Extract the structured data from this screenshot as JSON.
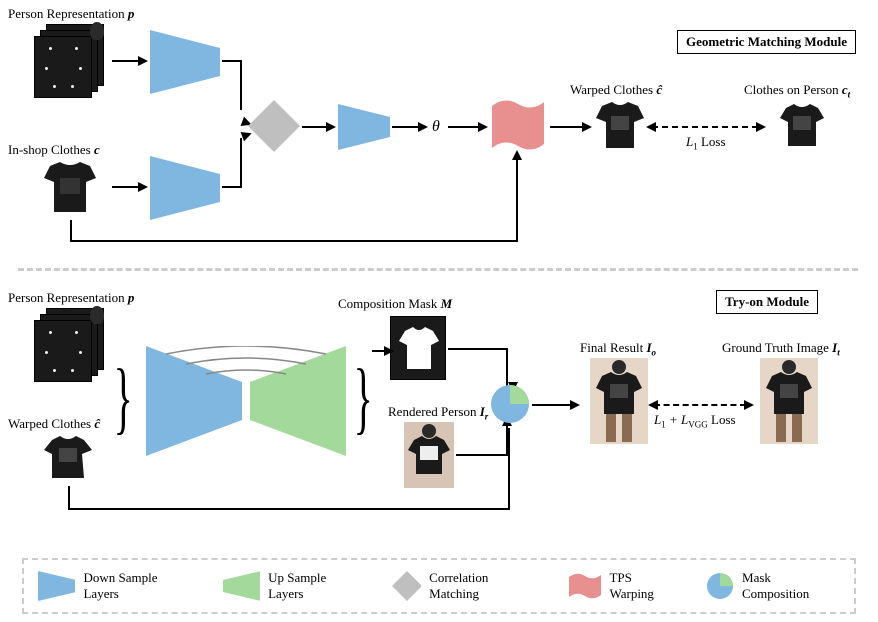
{
  "module1": {
    "title": "Geometric Matching Module"
  },
  "module2": {
    "title": "Try-on Module"
  },
  "labels": {
    "person_rep": "Person Representation",
    "person_rep_sym": "p",
    "inshop_clothes": "In-shop Clothes",
    "inshop_clothes_sym": "c",
    "theta": "θ",
    "warped_clothes": "Warped Clothes",
    "warped_clothes_sym": "ĉ",
    "clothes_on_person": "Clothes on Person",
    "clothes_on_person_sym": "c",
    "clothes_on_person_sub": "t",
    "l1_loss_pre": "L",
    "l1_loss_sub": "1",
    "l1_loss_post": " Loss",
    "comp_mask": "Composition Mask",
    "comp_mask_sym": "M",
    "rendered_person": "Rendered Person",
    "rendered_person_sym": "I",
    "rendered_person_sub": "r",
    "final_result": "Final Result",
    "final_result_sym": "I",
    "final_result_sub": "o",
    "ground_truth": "Ground Truth Image",
    "ground_truth_sym": "I",
    "ground_truth_sub": "t",
    "loss2_pre": "L",
    "loss2_s1": "1",
    "loss2_mid": " + L",
    "loss2_s2": "VGG",
    "loss2_post": " Loss"
  },
  "legend": {
    "down": "Down Sample Layers",
    "up": "Up Sample Layers",
    "corr": "Correlation Matching",
    "tps": "TPS Warping",
    "mask": "Mask Composition"
  }
}
